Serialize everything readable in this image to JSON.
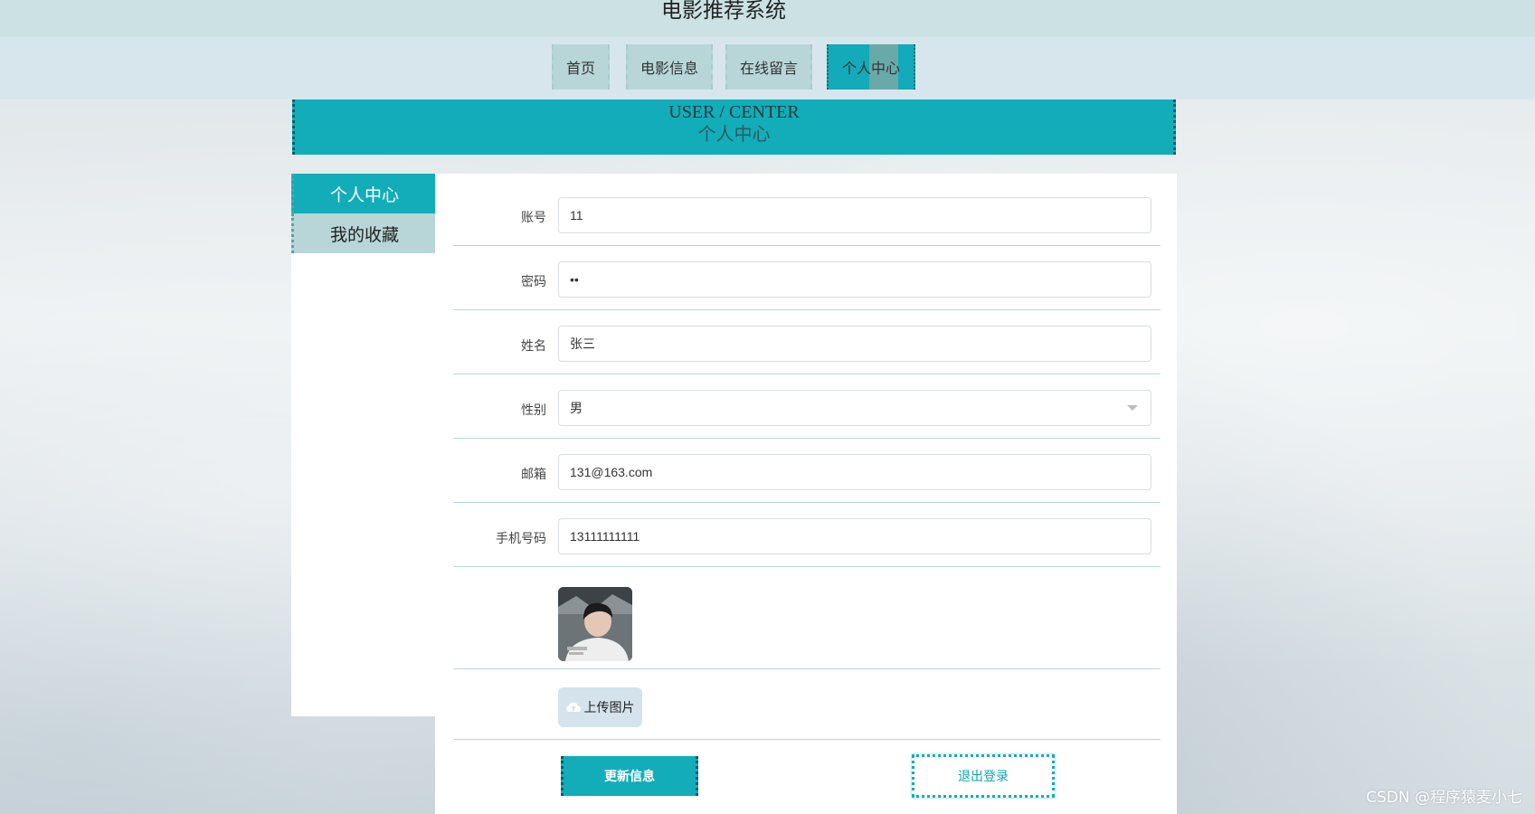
{
  "site": {
    "title": "电影推荐系统"
  },
  "nav": {
    "items": [
      {
        "label": "首页"
      },
      {
        "label": "电影信息"
      },
      {
        "label": "在线留言"
      },
      {
        "label": "个人中心"
      }
    ]
  },
  "header": {
    "en": "USER / CENTER",
    "cn": "个人中心"
  },
  "sidebar": {
    "items": [
      {
        "label": "个人中心"
      },
      {
        "label": "我的收藏"
      }
    ]
  },
  "form": {
    "account": {
      "label": "账号",
      "value": "11"
    },
    "password": {
      "label": "密码",
      "value": "••"
    },
    "name": {
      "label": "姓名",
      "value": "张三"
    },
    "gender": {
      "label": "性别",
      "value": "男"
    },
    "email": {
      "label": "邮箱",
      "value": "131@163.com"
    },
    "phone": {
      "label": "手机号码",
      "value": "13111111111"
    },
    "upload_label": "上传图片",
    "update_label": "更新信息",
    "logout_label": "退出登录"
  },
  "watermark": "CSDN @程序猿麦小七",
  "colors": {
    "accent": "#12adb9",
    "nav_bg": "#b8d6d8",
    "topbar": "#cbe1e3"
  }
}
